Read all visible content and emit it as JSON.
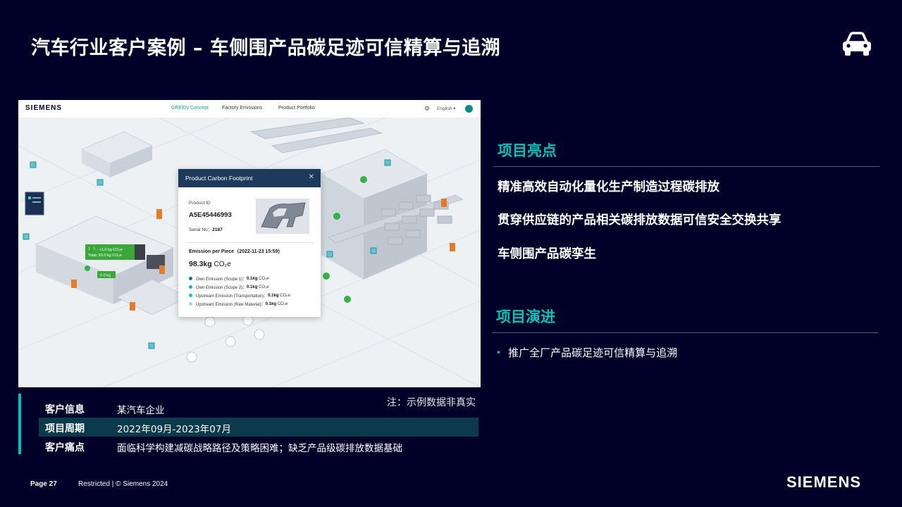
{
  "slide": {
    "title": "汽车行业客户案例 – 车侧围产品碳足迹可信精算与追溯",
    "car_icon": "car-icon"
  },
  "screenshot": {
    "brand": "SIEMENS",
    "nav": [
      "GREEN Concept",
      "Factory Emissions",
      "Product Portfolio"
    ],
    "language": "English ▾",
    "card": {
      "title": "Product Carbon Footprint",
      "product_id_label": "Product ID",
      "product_id": "A5E45446993",
      "serial_label": "Serial No：",
      "serial_value": "2187",
      "emission_label": "Emission per Piece（2022-11-23 15:59)",
      "total_value": "98.3kg",
      "total_unit": "CO₂e",
      "rows": [
        {
          "label": "Own Emission (Scope 1)：",
          "value": "0.1kg",
          "unit": "CO₂e",
          "color": "#0e7a7a"
        },
        {
          "label": "Own Emission (Scope 2)：",
          "value": "0.1kg",
          "unit": "CO₂e",
          "color": "#1bb0b0"
        },
        {
          "label": "Upstream Emission (Transportation)：",
          "value": "0.1kg",
          "unit": "CO₂e",
          "color": "#19c6a4"
        },
        {
          "label": "Upstream Emission (Raw Material)：",
          "value": "0.1kg",
          "unit": "CO₂e",
          "color": "#9fdcc4"
        }
      ]
    },
    "scene_tags": {
      "green_tag_line1": "？ ？: +1.0 kg CO₂e",
      "green_tag_line2": "Total: 50.0 kg CO₂e",
      "small_tag": "0.0 kg"
    }
  },
  "highlights": {
    "title": "项目亮点",
    "items": [
      "精准高效自动化量化生产制造过程碳排放",
      "贯穿供应链的产品相关碳排放数据可信安全交换共享",
      "车侧围产品碳孪生"
    ]
  },
  "progress": {
    "title": "项目演进",
    "items": [
      "推广全厂产品碳足迹可信精算与追溯"
    ]
  },
  "note": "注：示例数据非真实",
  "customer": {
    "rows": [
      {
        "key": "客户信息",
        "value": "某汽车企业"
      },
      {
        "key": "项目周期",
        "value": "2022年09月-2023年07月"
      },
      {
        "key": "客户痛点",
        "value": "面临科学构建减碳战略路径及策略困难；缺乏产品级碳排放数据基础"
      }
    ]
  },
  "footer": {
    "page": "Page 27",
    "restricted": "Restricted | © Siemens 2024",
    "logo": "SIEMENS"
  },
  "colors": {
    "background": "#000028",
    "accent": "#00c1b6",
    "card_header": "#1c3a5c"
  }
}
